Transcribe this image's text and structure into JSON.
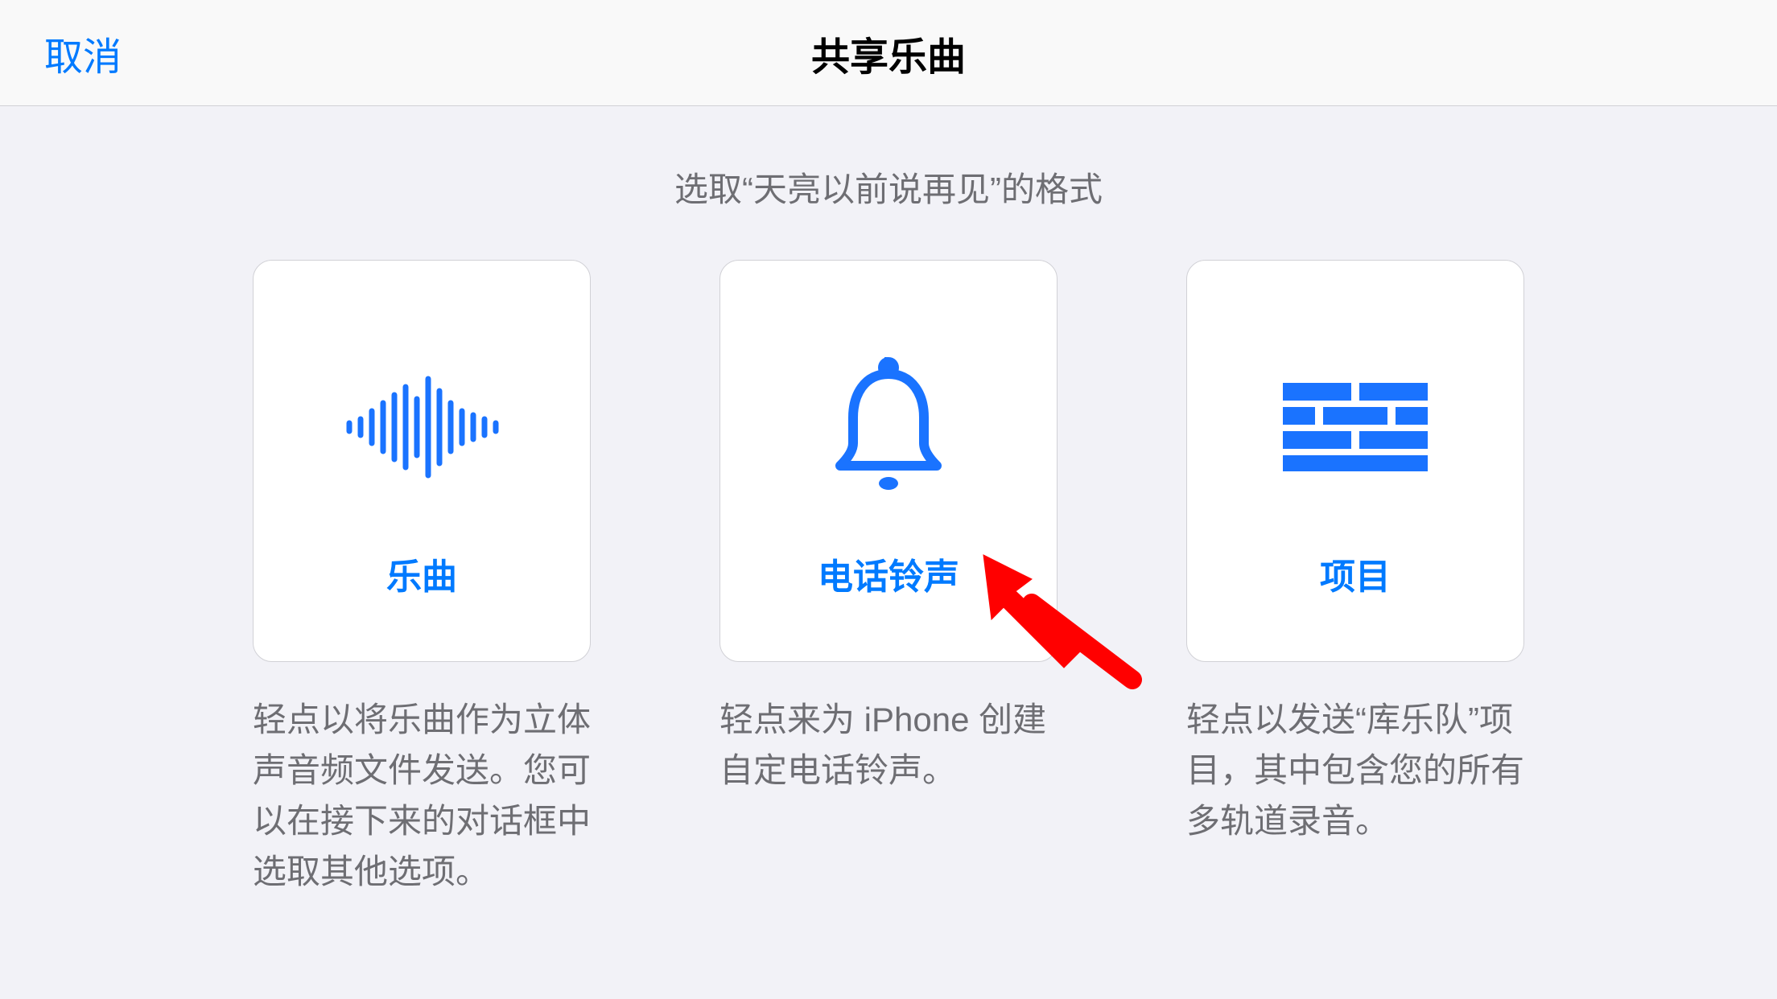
{
  "header": {
    "cancel_label": "取消",
    "title": "共享乐曲"
  },
  "subtitle": "选取“天亮以前说再见”的格式",
  "options": [
    {
      "label": "乐曲",
      "desc": "轻点以将乐曲作为立体声音频文件发送。您可以在接下来的对话框中选取其他选项。"
    },
    {
      "label": "电话铃声",
      "desc": "轻点来为 iPhone 创建自定电话铃声。"
    },
    {
      "label": "项目",
      "desc": "轻点以发送“库乐队”项目，其中包含您的所有多轨道录音。"
    }
  ]
}
